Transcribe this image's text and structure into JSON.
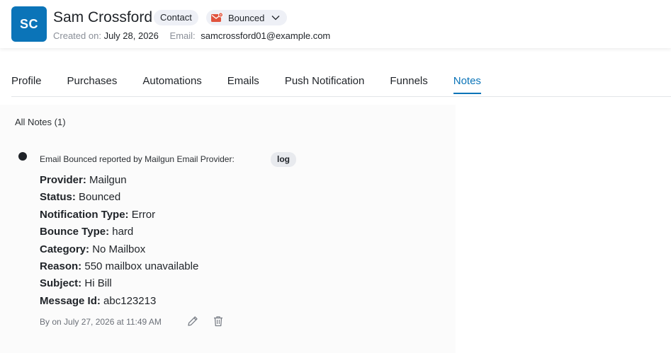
{
  "contact": {
    "initials": "SC",
    "name": "Sam Crossford",
    "type_badge": "Contact",
    "status": "Bounced",
    "created_label": "Created on:",
    "created_value": "July 28, 2026",
    "email_label": "Email:",
    "email_value": "samcrossford01@example.com"
  },
  "tabs": [
    {
      "label": "Profile",
      "active": false
    },
    {
      "label": "Purchases",
      "active": false
    },
    {
      "label": "Automations",
      "active": false
    },
    {
      "label": "Emails",
      "active": false
    },
    {
      "label": "Push Notification",
      "active": false
    },
    {
      "label": "Funnels",
      "active": false
    },
    {
      "label": "Notes",
      "active": true
    }
  ],
  "notes": {
    "heading": "All Notes (1)",
    "items": [
      {
        "title": "Email Bounced reported by Mailgun Email Provider:",
        "tag": "log",
        "details": [
          {
            "label": "Provider:",
            "value": "Mailgun"
          },
          {
            "label": "Status:",
            "value": "Bounced"
          },
          {
            "label": "Notification Type:",
            "value": "Error"
          },
          {
            "label": "Bounce Type:",
            "value": "hard"
          },
          {
            "label": "Category:",
            "value": "No Mailbox"
          },
          {
            "label": "Reason:",
            "value": "550 mailbox unavailable"
          },
          {
            "label": "Subject:",
            "value": "Hi Bill"
          },
          {
            "label": "Message Id:",
            "value": "abc123213"
          }
        ],
        "footer": "By on July 27, 2026 at 11:49 AM"
      }
    ]
  },
  "icons": {
    "status": "bounced-mail-icon",
    "dropdown": "chevron-down-icon",
    "edit": "pencil-icon",
    "delete": "trash-icon"
  },
  "colors": {
    "accent": "#0b74b8",
    "avatar_bg": "#0b74b8",
    "bounced_icon": "#e0533d"
  }
}
